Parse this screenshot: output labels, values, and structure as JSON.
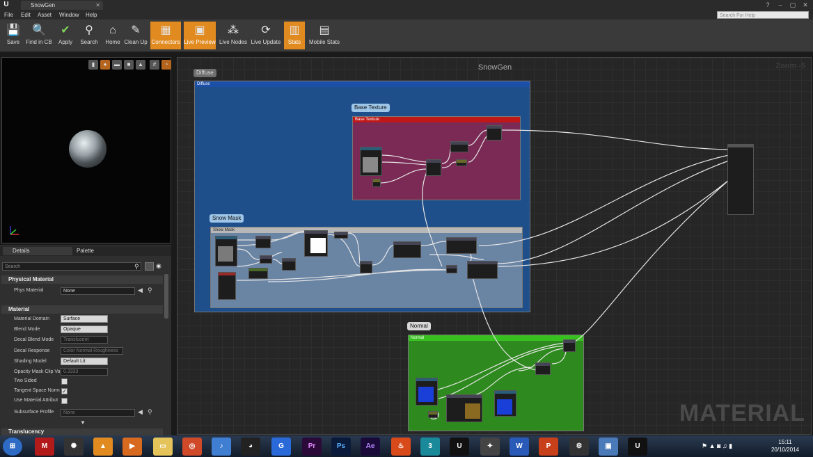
{
  "window": {
    "tab_title": "SnowGen"
  },
  "menu": [
    "File",
    "Edit",
    "Asset",
    "Window",
    "Help"
  ],
  "search_help_placeholder": "Search For Help",
  "toolbar": [
    {
      "label": "Save",
      "icon": "save-icon",
      "active": false
    },
    {
      "label": "Find in CB",
      "icon": "magnifier-icon",
      "active": false
    },
    {
      "label": "Apply",
      "icon": "checkmark-icon",
      "active": false
    },
    {
      "label": "Search",
      "icon": "binoculars-icon",
      "active": false
    },
    {
      "label": "Home",
      "icon": "home-icon",
      "active": false
    },
    {
      "label": "Clean Up",
      "icon": "broom-icon",
      "active": false
    },
    {
      "label": "Connectors",
      "icon": "connectors-icon",
      "active": true
    },
    {
      "label": "Live Preview",
      "icon": "preview-icon",
      "active": true
    },
    {
      "label": "Live Nodes",
      "icon": "nodes-icon",
      "active": false
    },
    {
      "label": "Live Update",
      "icon": "update-icon",
      "active": false
    },
    {
      "label": "Stats",
      "icon": "stats-icon",
      "active": true
    },
    {
      "label": "Mobile Stats",
      "icon": "mobile-stats-icon",
      "active": false
    }
  ],
  "panel_tabs": {
    "details": "Details",
    "palette": "Palette"
  },
  "details_search_placeholder": "Search",
  "categories": {
    "physical": "Physical Material",
    "material": "Material",
    "translucency": "Translucency"
  },
  "physical_material": {
    "label": "Phys Material",
    "value": "None"
  },
  "material_props": [
    {
      "label": "Material Domain",
      "value": "Surface",
      "type": "dropdown-light"
    },
    {
      "label": "Blend Mode",
      "value": "Opaque",
      "type": "dropdown-light"
    },
    {
      "label": "Decal Blend Mode",
      "value": "Translucent",
      "type": "dropdown-disabled"
    },
    {
      "label": "Decal Response",
      "value": "Color Normal Roughness",
      "type": "dropdown-disabled"
    },
    {
      "label": "Shading Model",
      "value": "Default Lit",
      "type": "dropdown-light"
    },
    {
      "label": "Opacity Mask Clip Va",
      "value": "0.3333",
      "type": "number-disabled"
    },
    {
      "label": "Two Sided",
      "value": "",
      "type": "checkbox",
      "checked": false
    },
    {
      "label": "Tangent Space Norm",
      "value": "",
      "type": "checkbox",
      "checked": true
    },
    {
      "label": "Use Material Attribut",
      "value": "",
      "type": "checkbox",
      "checked": false
    },
    {
      "label": "Subsurface Profile",
      "value": "None",
      "type": "dropdown-disabled"
    }
  ],
  "graph": {
    "title": "SnowGen",
    "zoom": "Zoom -5",
    "watermark": "MATERIAL",
    "comments": [
      {
        "bubble": "Diffuse",
        "header": "Diffuse",
        "color": "#1f4f8a",
        "head_color": "#1c4fa8"
      },
      {
        "bubble": "Base Texture",
        "header": "Base Texture",
        "color": "#7a2a55",
        "head_color": "#c01818"
      },
      {
        "bubble": "Snow Mask",
        "header": "Snow Mask",
        "color": "#6a84a4",
        "head_color": "#b8b8b8"
      },
      {
        "bubble": "Normal",
        "header": "Normal",
        "color": "#2e8a1e",
        "head_color": "#38c020"
      }
    ]
  },
  "taskbar": {
    "time": "15:11",
    "date": "20/10/2014"
  }
}
